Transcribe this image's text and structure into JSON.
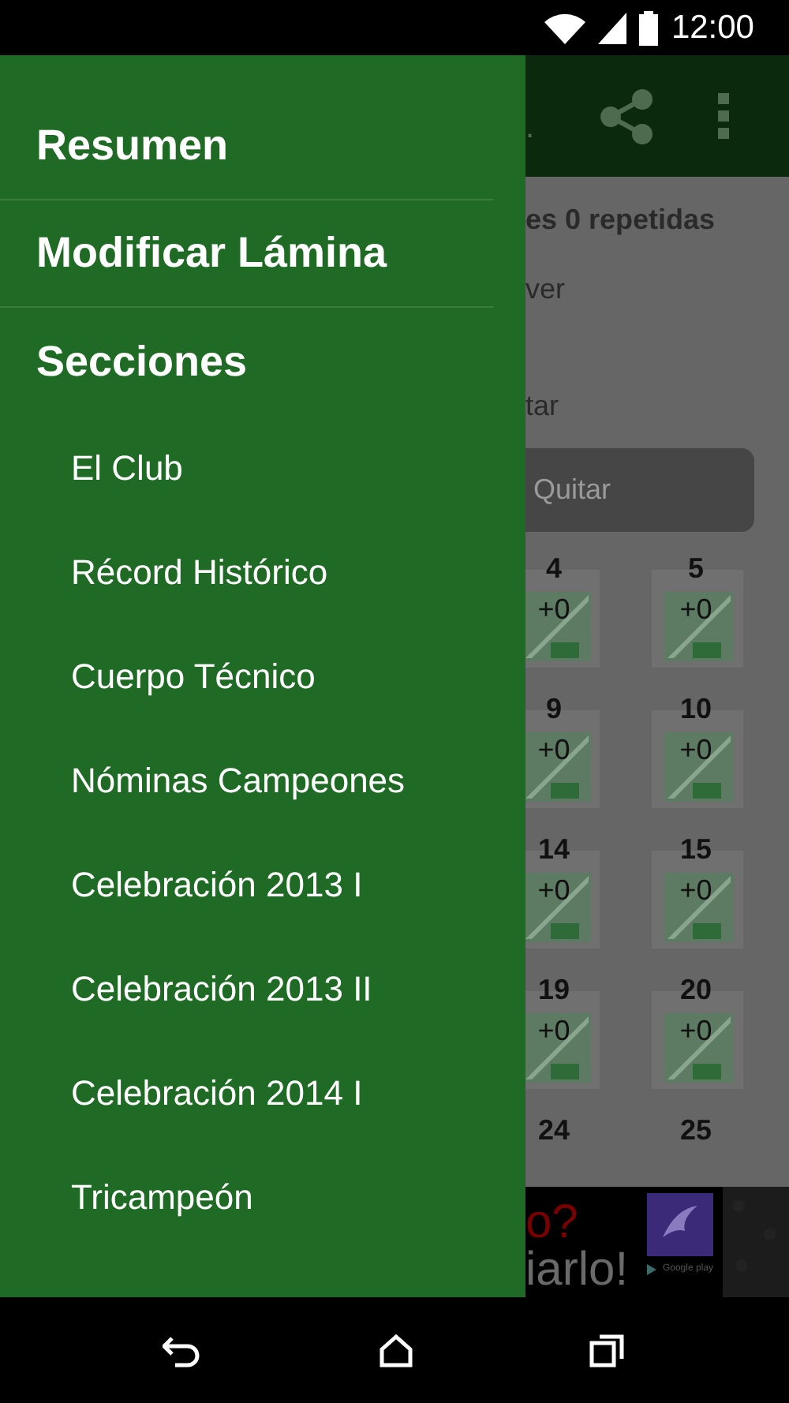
{
  "status_bar": {
    "time": "12:00"
  },
  "drawer": {
    "items": [
      {
        "kind": "header",
        "label": "Resumen"
      },
      {
        "kind": "header",
        "label": "Modificar Lámina"
      },
      {
        "kind": "header",
        "label": "Secciones"
      },
      {
        "kind": "section",
        "label": "El Club"
      },
      {
        "kind": "section",
        "label": "Récord Histórico"
      },
      {
        "kind": "section",
        "label": "Cuerpo Técnico"
      },
      {
        "kind": "section",
        "label": "Nóminas Campeones"
      },
      {
        "kind": "section",
        "label": "Celebración 2013 I"
      },
      {
        "kind": "section",
        "label": "Celebración 2013 II"
      },
      {
        "kind": "section",
        "label": "Celebración 2014 I"
      },
      {
        "kind": "section",
        "label": "Tricampeón"
      }
    ]
  },
  "background": {
    "title": ".",
    "summary": "es 0 repetidas",
    "line_1": "ver",
    "line_2": "tar",
    "button": "Quitar",
    "stickers": [
      {
        "number": "4",
        "count": "+0"
      },
      {
        "number": "5",
        "count": "+0"
      },
      {
        "number": "9",
        "count": "+0"
      },
      {
        "number": "10",
        "count": "+0"
      },
      {
        "number": "14",
        "count": "+0"
      },
      {
        "number": "15",
        "count": "+0"
      },
      {
        "number": "19",
        "count": "+0"
      },
      {
        "number": "20",
        "count": "+0"
      },
      {
        "number": "24"
      },
      {
        "number": "25"
      }
    ]
  },
  "ad": {
    "headline": "o?",
    "cta": "iarlo!",
    "store": "Google play"
  }
}
